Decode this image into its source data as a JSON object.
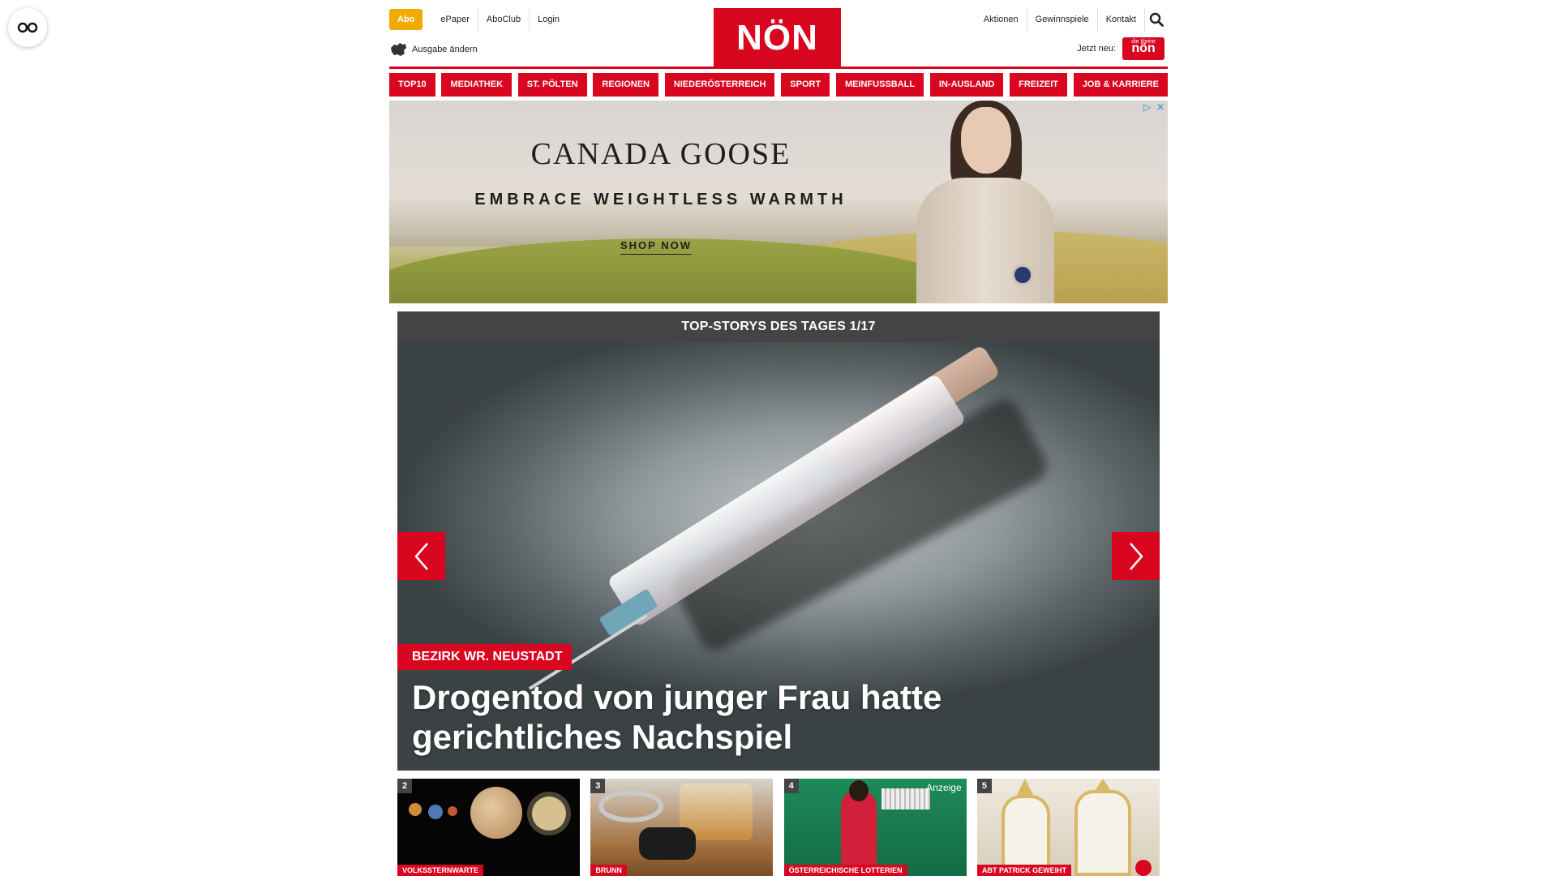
{
  "topbar": {
    "abo_label": "Abo",
    "left_links": [
      "ePaper",
      "AboClub",
      "Login"
    ],
    "right_links": [
      "Aktionen",
      "Gewinnspiele",
      "Kontakt"
    ],
    "edition_label": "Ausgabe ändern",
    "jetzt_label": "Jetzt neu:",
    "kleine_logo_small": "die kleine",
    "kleine_logo_text": "nön"
  },
  "logo": {
    "text": "NÖN"
  },
  "mainnav": {
    "items": [
      "TOP10",
      "MEDIATHEK",
      "ST. PÖLTEN",
      "REGIONEN",
      "NIEDERÖSTERREICH",
      "SPORT",
      "MEINFUSSBALL",
      "IN-AUSLAND",
      "FREIZEIT",
      "JOB & KARRIERE"
    ]
  },
  "ad": {
    "brand": "CANADA GOOSE",
    "tagline": "EMBRACE WEIGHTLESS WARMTH",
    "cta": "SHOP NOW"
  },
  "stories": {
    "header": "TOP-STORYS DES TAGES 1/17",
    "main": {
      "tag": "BEZIRK WR. NEUSTADT",
      "title": "Drogentod von junger Frau hatte gerichtliches Nachspiel"
    },
    "thumbs": [
      {
        "num": "2",
        "tag": "VOLKSSTERNWARTE"
      },
      {
        "num": "3",
        "tag": "BRUNN"
      },
      {
        "num": "4",
        "tag": "ÖSTERREICHISCHE LOTTERIEN",
        "badge": "Anzeige"
      },
      {
        "num": "5",
        "tag": "ABT PATRICK GEWEIHT"
      }
    ]
  },
  "colors": {
    "brand_red": "#d8061e",
    "abo_orange": "#f2a900",
    "header_grey": "#444444"
  }
}
